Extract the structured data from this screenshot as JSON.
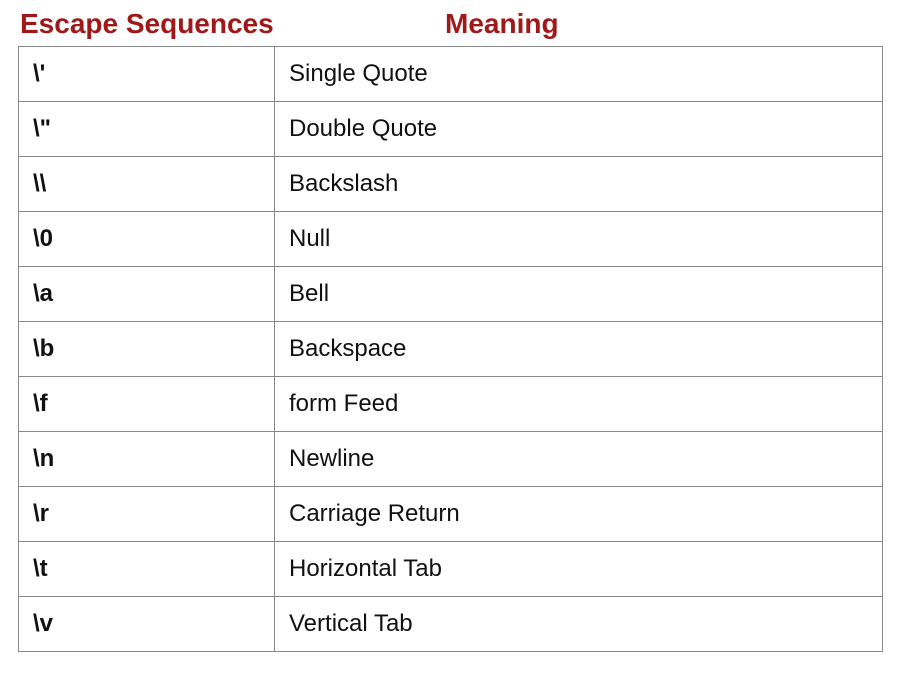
{
  "headers": {
    "left": "Escape Sequences",
    "right": "Meaning"
  },
  "rows": [
    {
      "seq": "\\'",
      "mean": "Single Quote"
    },
    {
      "seq": "\\\"",
      "mean": "Double Quote"
    },
    {
      "seq": "\\\\",
      "mean": "Backslash"
    },
    {
      "seq": "\\0",
      "mean": "Null"
    },
    {
      "seq": "\\a",
      "mean": "Bell"
    },
    {
      "seq": "\\b",
      "mean": "Backspace"
    },
    {
      "seq": "\\f",
      "mean": "form Feed"
    },
    {
      "seq": "\\n",
      "mean": "Newline"
    },
    {
      "seq": "\\r",
      "mean": "Carriage Return"
    },
    {
      "seq": "\\t",
      "mean": "Horizontal Tab"
    },
    {
      "seq": "\\v",
      "mean": "Vertical Tab"
    }
  ]
}
